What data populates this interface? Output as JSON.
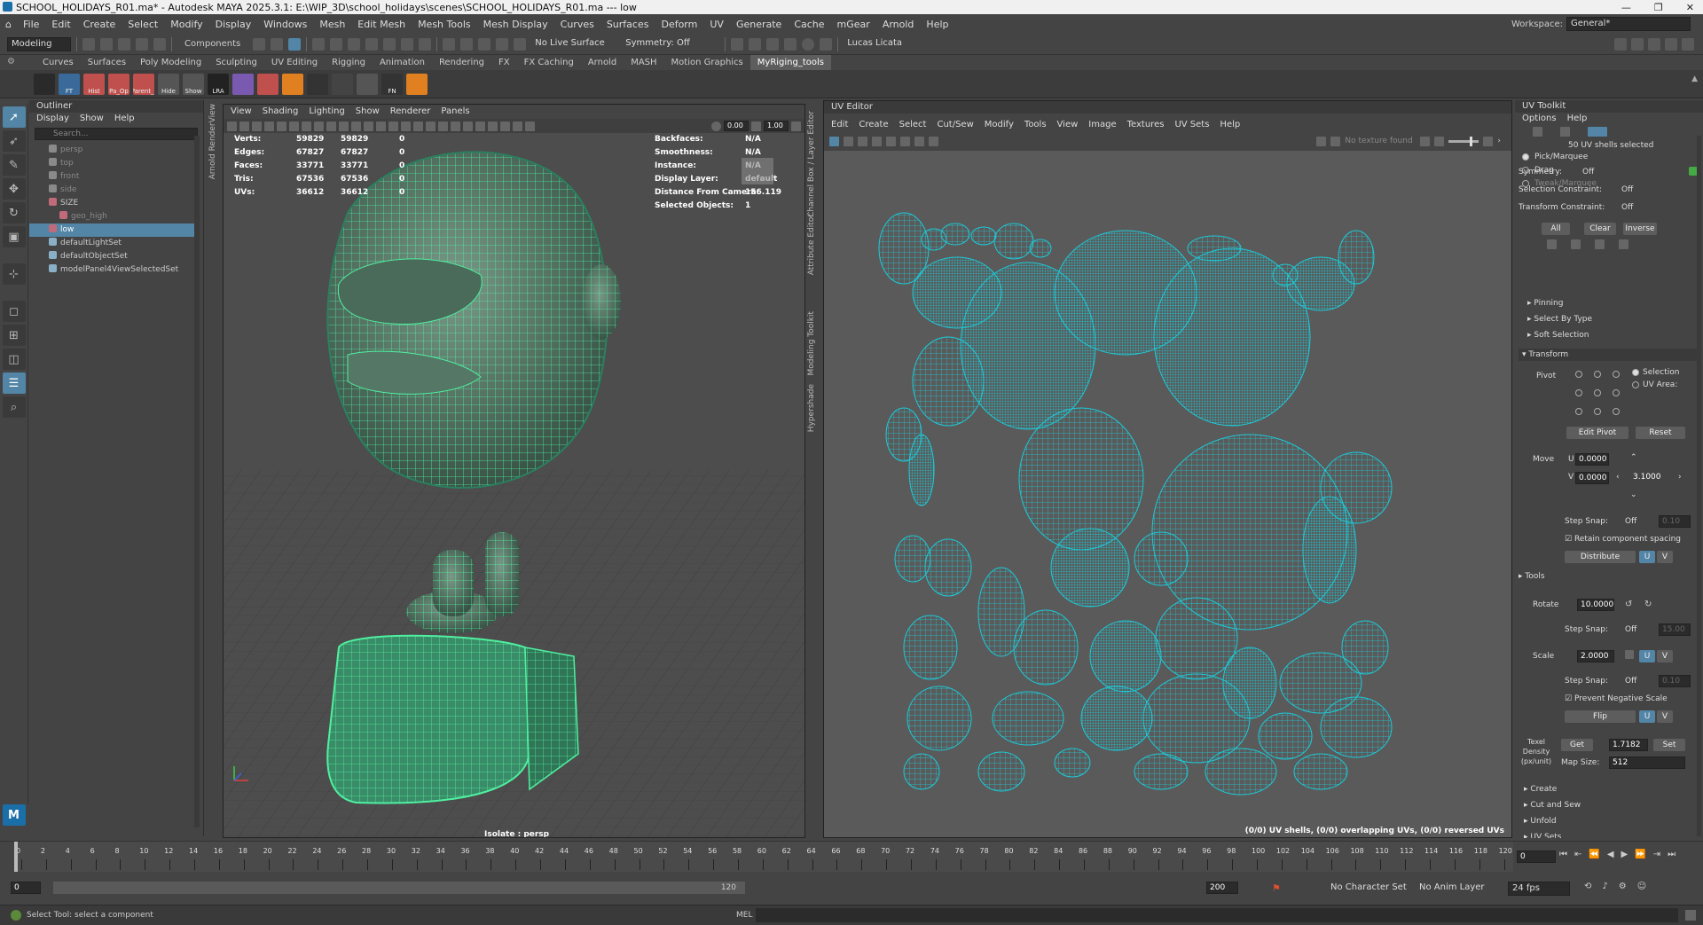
{
  "window": {
    "title": "SCHOOL_HOLIDAYS_R01.ma* - Autodesk MAYA 2025.3.1: E:\\WIP_3D\\school_holidays\\scenes\\SCHOOL_HOLIDAYS_R01.ma  ---  low",
    "controls": [
      "—",
      "❐",
      "✕"
    ]
  },
  "menubar": {
    "items": [
      "File",
      "Edit",
      "Create",
      "Select",
      "Modify",
      "Display",
      "Windows",
      "Mesh",
      "Edit Mesh",
      "Mesh Tools",
      "Mesh Display",
      "Curves",
      "Surfaces",
      "Deform",
      "UV",
      "Generate",
      "Cache",
      "mGear",
      "Arnold",
      "Help"
    ],
    "workspace_label": "Workspace:",
    "workspace_value": "General*"
  },
  "statusline": {
    "mode": "Modeling",
    "component_label": "Components",
    "live_surface": "No Live Surface",
    "symmetry": "Symmetry: Off",
    "user": "Lucas Licata"
  },
  "shelf": {
    "tabs": [
      "Curves",
      "Surfaces",
      "Poly Modeling",
      "Sculpting",
      "UV Editing",
      "Rigging",
      "Animation",
      "Rendering",
      "FX",
      "FX Caching",
      "Arnold",
      "MASH",
      "Motion Graphics",
      "MyRiging_tools"
    ],
    "active_tab": "MyRiging_tools",
    "buttons": [
      "",
      "FT",
      "Hist",
      "Pa_Op",
      "Parent_(",
      "Hide",
      "Show",
      "LRA",
      "",
      "",
      "",
      "",
      "",
      "",
      "FN",
      ""
    ]
  },
  "outliner": {
    "title": "Outliner",
    "menu": [
      "Display",
      "Show",
      "Help"
    ],
    "search_placeholder": "Search...",
    "items": [
      {
        "label": "persp",
        "indent": 1,
        "dim": true,
        "selected": false,
        "color": "#8a8a8a"
      },
      {
        "label": "top",
        "indent": 1,
        "dim": true,
        "selected": false,
        "color": "#8a8a8a"
      },
      {
        "label": "front",
        "indent": 1,
        "dim": true,
        "selected": false,
        "color": "#8a8a8a"
      },
      {
        "label": "side",
        "indent": 1,
        "dim": true,
        "selected": false,
        "color": "#8a8a8a"
      },
      {
        "label": "SIZE",
        "indent": 1,
        "dim": false,
        "selected": false,
        "color": "#c06a7a"
      },
      {
        "label": "geo_high",
        "indent": 2,
        "dim": true,
        "selected": false,
        "color": "#c06a7a"
      },
      {
        "label": "low",
        "indent": 1,
        "dim": false,
        "selected": true,
        "color": "#c06a7a"
      },
      {
        "label": "defaultLightSet",
        "indent": 1,
        "dim": false,
        "selected": false,
        "color": "#8ab0c8"
      },
      {
        "label": "defaultObjectSet",
        "indent": 1,
        "dim": false,
        "selected": false,
        "color": "#8ab0c8"
      },
      {
        "label": "modelPanel4ViewSelectedSet",
        "indent": 1,
        "dim": false,
        "selected": false,
        "color": "#8ab0c8"
      }
    ]
  },
  "viewport": {
    "menu": [
      "View",
      "Shading",
      "Lighting",
      "Show",
      "Renderer",
      "Panels"
    ],
    "exposure": "0.00",
    "gamma": "1.00",
    "hud_left": [
      {
        "label": "Verts:",
        "v1": "59829",
        "v2": "59829",
        "v3": "0"
      },
      {
        "label": "Edges:",
        "v1": "67827",
        "v2": "67827",
        "v3": "0"
      },
      {
        "label": "Faces:",
        "v1": "33771",
        "v2": "33771",
        "v3": "0"
      },
      {
        "label": "Tris:",
        "v1": "67536",
        "v2": "67536",
        "v3": "0"
      },
      {
        "label": "UVs:",
        "v1": "36612",
        "v2": "36612",
        "v3": "0"
      }
    ],
    "hud_right": [
      {
        "label": "Backfaces:",
        "value": "N/A"
      },
      {
        "label": "Smoothness:",
        "value": "N/A"
      },
      {
        "label": "Instance:",
        "value": "N/A"
      },
      {
        "label": "Display Layer:",
        "value": "default"
      },
      {
        "label": "Distance From Camera:",
        "value": "156.119"
      },
      {
        "label": "Selected Objects:",
        "value": "1"
      }
    ],
    "isolate_label": "Isolate : persp",
    "side_tabs": [
      "Arnold RenderView"
    ]
  },
  "side_tabs": [
    "Channel Box / Layer Editor",
    "Attribute Editor",
    "Modeling Toolkit",
    "Hypershade"
  ],
  "uv_editor": {
    "title": "UV Editor",
    "menu": [
      "Edit",
      "Create",
      "Select",
      "Cut/Sew",
      "Modify",
      "Tools",
      "View",
      "Image",
      "Textures",
      "UV Sets",
      "Help"
    ],
    "texture_label": "No texture found",
    "status": "(0/0) UV shells, (0/0) overlapping UVs, (0/0) reversed UVs",
    "shell_color": "#1ccad8"
  },
  "uv_toolkit": {
    "title": "UV Toolkit",
    "menu": [
      "Options",
      "Help"
    ],
    "shells_selected": "50 UV shells selected",
    "pick_modes": [
      "Pick/Marquee",
      "Drag",
      "Tweak/Marquee"
    ],
    "symmetry_label": "Symmetry:",
    "symmetry_value": "Off",
    "selection_constraint_label": "Selection Constraint:",
    "selection_constraint_value": "Off",
    "transform_constraint_label": "Transform Constraint:",
    "transform_constraint_value": "Off",
    "sel_buttons": [
      "All",
      "Clear",
      "Inverse"
    ],
    "sections_top": [
      "Pinning",
      "Select By Type",
      "Soft Selection"
    ],
    "transform_label": "Transform",
    "pivot_label": "Pivot",
    "pivot_options": [
      "Selection",
      "UV Area:"
    ],
    "edit_pivot": "Edit Pivot",
    "reset": "Reset",
    "move_label": "Move",
    "move_u_label": "U",
    "move_u": "0.0000",
    "move_v_label": "V",
    "move_v": "0.0000",
    "move_step": "3.1000",
    "step_snap_label": "Step Snap:",
    "step_snap_value": "Off",
    "step_snap_num": "0.10",
    "retain_spacing": "Retain component spacing",
    "distribute": "Distribute",
    "u_btn": "U",
    "v_btn": "V",
    "tools_label": "Tools",
    "rotate_label": "Rotate",
    "rotate_value": "10.0000",
    "rotate_snap_num": "15.00",
    "scale_label": "Scale",
    "scale_value": "2.0000",
    "scale_snap_num": "0.10",
    "prevent_negative": "Prevent Negative Scale",
    "flip": "Flip",
    "texel_density_label": "Texel Density (px/unit)",
    "get": "Get",
    "texel_value": "1.7182",
    "set": "Set",
    "map_size_label": "Map Size:",
    "map_size_value": "512",
    "sections_bottom": [
      "Create",
      "Cut and Sew",
      "Unfold",
      "UV Sets"
    ]
  },
  "timeline": {
    "ticks": [
      "0",
      "2",
      "4",
      "6",
      "8",
      "10",
      "12",
      "14",
      "16",
      "18",
      "20",
      "22",
      "24",
      "26",
      "28",
      "30",
      "32",
      "34",
      "36",
      "38",
      "40",
      "42",
      "44",
      "46",
      "48",
      "50",
      "52",
      "54",
      "56",
      "58",
      "60",
      "62",
      "64",
      "66",
      "68",
      "70",
      "72",
      "74",
      "76",
      "78",
      "80",
      "82",
      "84",
      "86",
      "88",
      "90",
      "92",
      "94",
      "96",
      "98",
      "100",
      "102",
      "104",
      "106",
      "108",
      "110",
      "112",
      "114",
      "116",
      "118",
      "120"
    ],
    "current_frame": "0",
    "range_start": "0",
    "range_inner_start": "0",
    "range_inner_end": "120",
    "range_end": "200",
    "character_set": "No Character Set",
    "anim_layer": "No Anim Layer",
    "fps": "24 fps"
  },
  "commandline": {
    "help_text": "Select Tool: select a component",
    "mel_label": "MEL"
  },
  "colors": {
    "accent": "#5285a6",
    "wire": "#4ff0a0",
    "uv": "#1ccad8"
  }
}
